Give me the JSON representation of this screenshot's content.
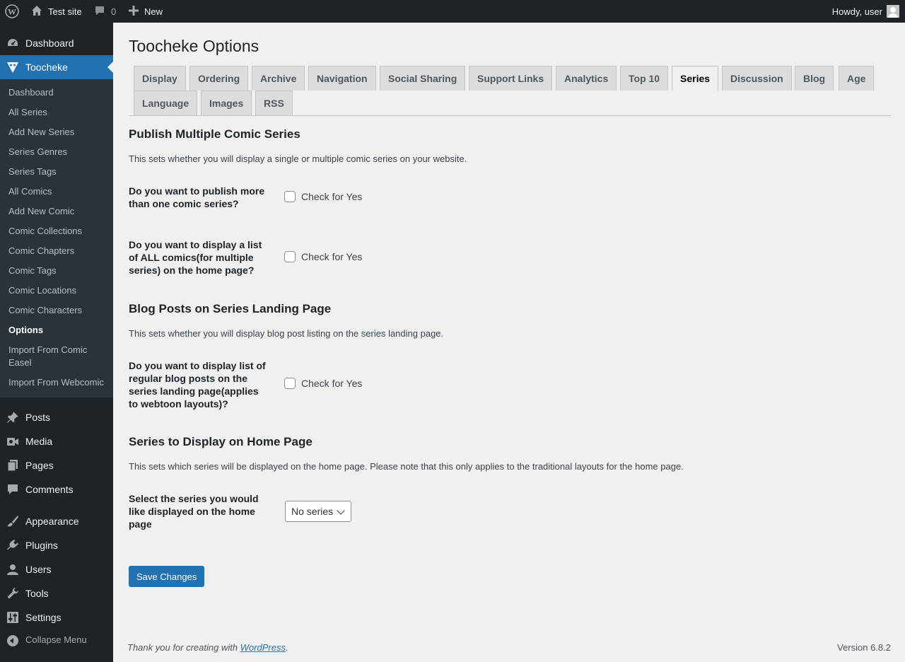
{
  "adminbar": {
    "site_name": "Test site",
    "comments_count": "0",
    "new_label": "New",
    "howdy": "Howdy, user"
  },
  "sidebar": {
    "dashboard": "Dashboard",
    "plugin": "Toocheke",
    "submenu": [
      "Dashboard",
      "All Series",
      "Add New Series",
      "Series Genres",
      "Series Tags",
      "All Comics",
      "Add New Comic",
      "Comic Collections",
      "Comic Chapters",
      "Comic Tags",
      "Comic Locations",
      "Comic Characters",
      "Options",
      "Import From Comic Easel",
      "Import From Webcomic"
    ],
    "posts": "Posts",
    "media": "Media",
    "pages": "Pages",
    "comments": "Comments",
    "appearance": "Appearance",
    "plugins": "Plugins",
    "users": "Users",
    "tools": "Tools",
    "settings": "Settings",
    "collapse": "Collapse Menu"
  },
  "page": {
    "title": "Toocheke Options",
    "tabs": [
      "Display",
      "Ordering",
      "Archive",
      "Navigation",
      "Social Sharing",
      "Support Links",
      "Analytics",
      "Top 10",
      "Series",
      "Discussion",
      "Blog",
      "Age",
      "Language",
      "Images",
      "RSS"
    ],
    "active_tab": "Series"
  },
  "sections": {
    "multi": {
      "heading": "Publish Multiple Comic Series",
      "desc": "This sets whether you will display a single or multiple comic series on your website.",
      "q1": "Do you want to publish more than one comic series?",
      "q2": "Do you want to display a list of ALL comics(for multiple series) on the home page?"
    },
    "blog": {
      "heading": "Blog Posts on Series Landing Page",
      "desc": "This sets whether you will display blog post listing on the series landing page.",
      "q1": "Do you want to display list of regular blog posts on the series landing page(applies to webtoon layouts)?"
    },
    "home": {
      "heading": "Series to Display on Home Page",
      "desc": "This sets which series will be displayed on the home page. Please note that this only applies to the traditional layouts for the home page.",
      "q1": "Select the series you would like displayed on the home page",
      "select_value": "No series"
    },
    "check_label": "Check for Yes"
  },
  "save_label": "Save Changes",
  "footer": {
    "thanks_prefix": "Thank you for creating with ",
    "link": "WordPress",
    "thanks_suffix": ".",
    "version": "Version 6.8.2"
  }
}
